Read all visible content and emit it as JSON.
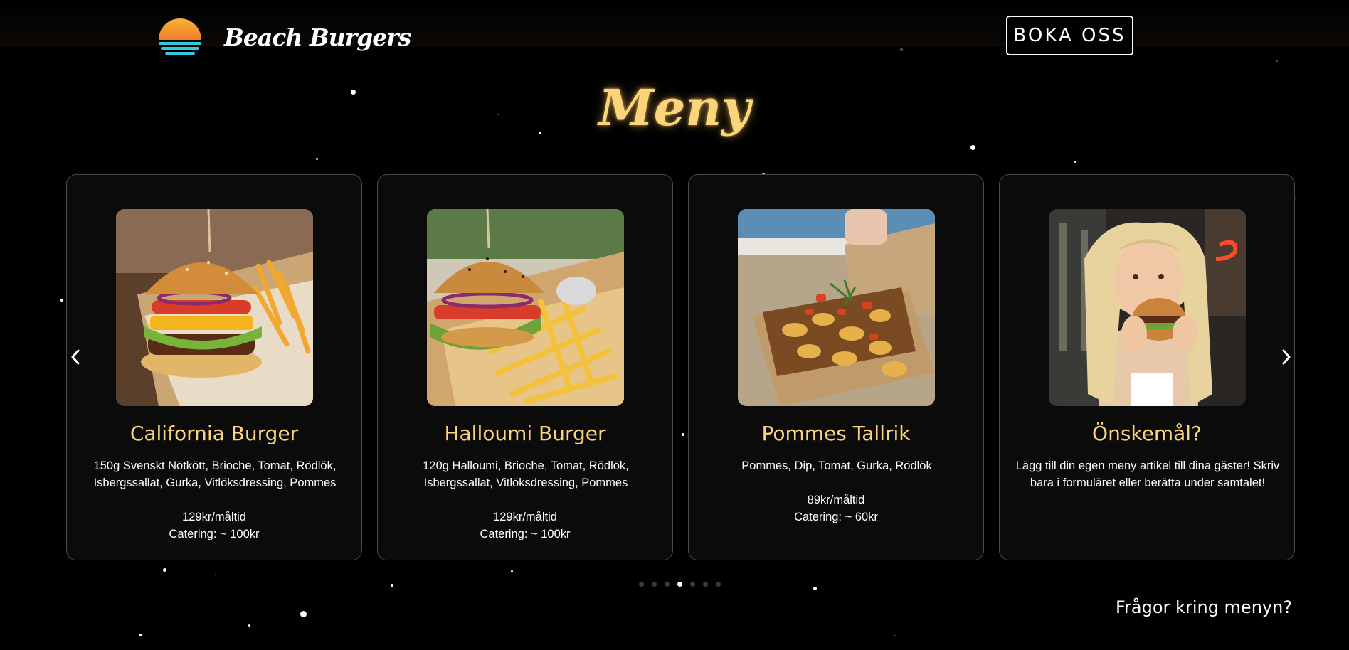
{
  "header": {
    "brand_name": "Beach Burgers",
    "book_button": "BOKA OSS"
  },
  "menu": {
    "title": "Meny",
    "cards": [
      {
        "name": "California Burger",
        "description": "150g Svenskt Nötkött, Brioche, Tomat, Rödlök, Isbergssallat, Gurka, Vitlöksdressing, Pommes",
        "price": "129kr/måltid",
        "catering": "Catering: ~ 100kr"
      },
      {
        "name": "Halloumi Burger",
        "description": "120g Halloumi, Brioche, Tomat, Rödlök, Isbergssallat, Vitlöksdressing, Pommes",
        "price": "129kr/måltid",
        "catering": "Catering: ~ 100kr"
      },
      {
        "name": "Pommes Tallrik",
        "description": "Pommes, Dip, Tomat, Gurka, Rödlök",
        "price": "89kr/måltid",
        "catering": "Catering: ~ 60kr"
      },
      {
        "name": "Önskemål?",
        "description": "Lägg till din egen meny artikel till dina gäster! Skriv bara i formuläret eller berätta under samtalet!"
      }
    ],
    "pagination": {
      "count": 7,
      "active_index": 3
    },
    "faq_link": "Frågor kring menyn?"
  },
  "colors": {
    "background": "#000000",
    "accent": "#fbd47c",
    "card_background": "#0b0b0b",
    "card_border": "#4a4a4a"
  },
  "icons": {
    "logo": "sunset-logo-icon",
    "prev": "chevron-left-icon",
    "next": "chevron-right-icon"
  }
}
